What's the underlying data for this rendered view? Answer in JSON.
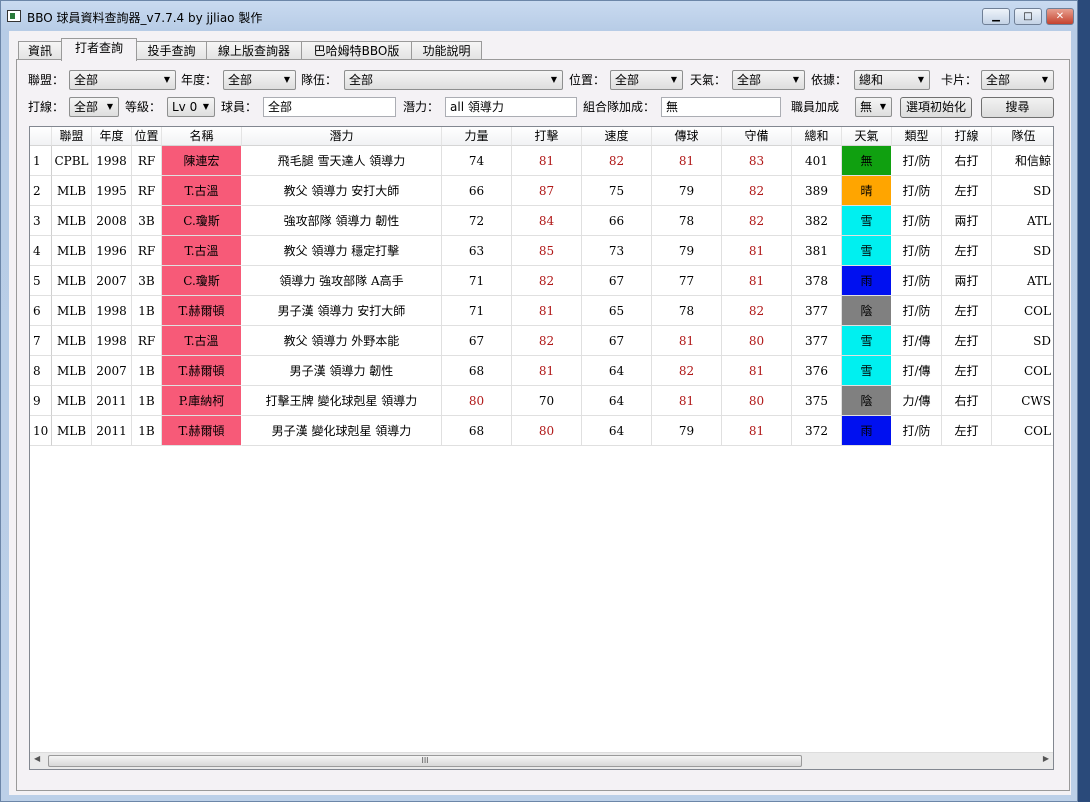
{
  "window": {
    "title": "BBO 球員資料查詢器_v7.7.4 by jjliao 製作"
  },
  "tabs": [
    {
      "label": "資訊"
    },
    {
      "label": "打者查詢",
      "active": true
    },
    {
      "label": "投手查詢"
    },
    {
      "label": "線上版查詢器"
    },
    {
      "label": "巴哈姆特BBO版"
    },
    {
      "label": "功能說明"
    }
  ],
  "filters": {
    "league": {
      "label": "聯盟：",
      "value": "全部"
    },
    "year": {
      "label": "年度：",
      "value": "全部"
    },
    "team": {
      "label": "隊伍：",
      "value": "全部"
    },
    "position": {
      "label": "位置：",
      "value": "全部"
    },
    "weather": {
      "label": "天氣：",
      "value": "全部"
    },
    "sort_by": {
      "label": "依據：",
      "value": "總和"
    },
    "card": {
      "label": "卡片：",
      "value": "全部"
    },
    "batting": {
      "label": "打線：",
      "value": "全部"
    },
    "level": {
      "label": "等級：",
      "value": "Lv 0"
    },
    "player": {
      "label": "球員：",
      "value": "全部"
    },
    "potential": {
      "label": "潛力：",
      "value": "all 領導力"
    },
    "combo_bonus": {
      "label": "組合隊加成：",
      "value": "無"
    },
    "staff_bonus": {
      "label": "職員加成",
      "value": "無"
    },
    "reset_button": "選項初始化",
    "search_button": "搜尋"
  },
  "table": {
    "columns": [
      "聯盟",
      "年度",
      "位置",
      "名稱",
      "潛力",
      "力量",
      "打擊",
      "速度",
      "傳球",
      "守備",
      "總和",
      "天氣",
      "類型",
      "打線",
      "隊伍"
    ],
    "highlight_threshold": 80,
    "name_color": "#f75a78",
    "weather_colors": {
      "無": "#10a010",
      "晴": "#ffa500",
      "雪": "#00f0f0",
      "雨": "#0010f0",
      "陰": "#808080"
    },
    "rows": [
      [
        "1",
        "CPBL",
        "1998",
        "RF",
        "陳連宏",
        "飛毛腿 雪天達人 領導力",
        "74",
        "81",
        "82",
        "81",
        "83",
        "401",
        "無",
        "打/防",
        "右打",
        "和信鯨"
      ],
      [
        "2",
        "MLB",
        "1995",
        "RF",
        "T.古溫",
        "教父 領導力 安打大師",
        "66",
        "87",
        "75",
        "79",
        "82",
        "389",
        "晴",
        "打/防",
        "左打",
        "SD"
      ],
      [
        "3",
        "MLB",
        "2008",
        "3B",
        "C.瓊斯",
        "強攻部隊 領導力 韌性",
        "72",
        "84",
        "66",
        "78",
        "82",
        "382",
        "雪",
        "打/防",
        "兩打",
        "ATL"
      ],
      [
        "4",
        "MLB",
        "1996",
        "RF",
        "T.古溫",
        "教父 領導力 穩定打擊",
        "63",
        "85",
        "73",
        "79",
        "81",
        "381",
        "雪",
        "打/防",
        "左打",
        "SD"
      ],
      [
        "5",
        "MLB",
        "2007",
        "3B",
        "C.瓊斯",
        "領導力 強攻部隊 A高手",
        "71",
        "82",
        "67",
        "77",
        "81",
        "378",
        "雨",
        "打/防",
        "兩打",
        "ATL"
      ],
      [
        "6",
        "MLB",
        "1998",
        "1B",
        "T.赫爾頓",
        "男子漢 領導力 安打大師",
        "71",
        "81",
        "65",
        "78",
        "82",
        "377",
        "陰",
        "打/防",
        "左打",
        "COL"
      ],
      [
        "7",
        "MLB",
        "1998",
        "RF",
        "T.古溫",
        "教父 領導力 外野本能",
        "67",
        "82",
        "67",
        "81",
        "80",
        "377",
        "雪",
        "打/傳",
        "左打",
        "SD"
      ],
      [
        "8",
        "MLB",
        "2007",
        "1B",
        "T.赫爾頓",
        "男子漢 領導力 韌性",
        "68",
        "81",
        "64",
        "82",
        "81",
        "376",
        "雪",
        "打/傳",
        "左打",
        "COL"
      ],
      [
        "9",
        "MLB",
        "2011",
        "1B",
        "P.庫納柯",
        "打擊王牌 變化球剋星 領導力",
        "80",
        "70",
        "64",
        "81",
        "80",
        "375",
        "陰",
        "力/傳",
        "右打",
        "CWS"
      ],
      [
        "10",
        "MLB",
        "2011",
        "1B",
        "T.赫爾頓",
        "男子漢 變化球剋星 領導力",
        "68",
        "80",
        "64",
        "79",
        "81",
        "372",
        "雨",
        "打/防",
        "左打",
        "COL"
      ]
    ]
  }
}
